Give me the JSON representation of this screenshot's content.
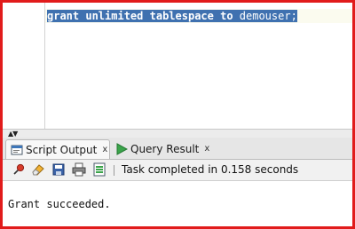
{
  "editor": {
    "sql_tokens": [
      {
        "text": "grant",
        "keyword": true
      },
      {
        "text": " ",
        "keyword": false
      },
      {
        "text": "unlimited",
        "keyword": true
      },
      {
        "text": " ",
        "keyword": false
      },
      {
        "text": "tablespace",
        "keyword": true
      },
      {
        "text": " ",
        "keyword": false
      },
      {
        "text": "to",
        "keyword": true
      },
      {
        "text": " demouser;",
        "keyword": false
      }
    ],
    "selection_color": "#3f71b0"
  },
  "tabs": {
    "script_output": {
      "label": "Script Output",
      "icon": "script-output-icon"
    },
    "query_result": {
      "label": "Query Result",
      "icon": "run-triangle-icon"
    },
    "close_glyph": "x"
  },
  "toolbar": {
    "icons": [
      "pin-icon",
      "eraser-icon",
      "save-icon",
      "print-icon",
      "export-icon"
    ],
    "status": "Task completed in 0.158 seconds"
  },
  "output": {
    "text": "Grant succeeded."
  },
  "colors": {
    "border": "#e11b1b",
    "tab_bar": "#e6e6e6",
    "run_icon": "#3aa44a"
  }
}
